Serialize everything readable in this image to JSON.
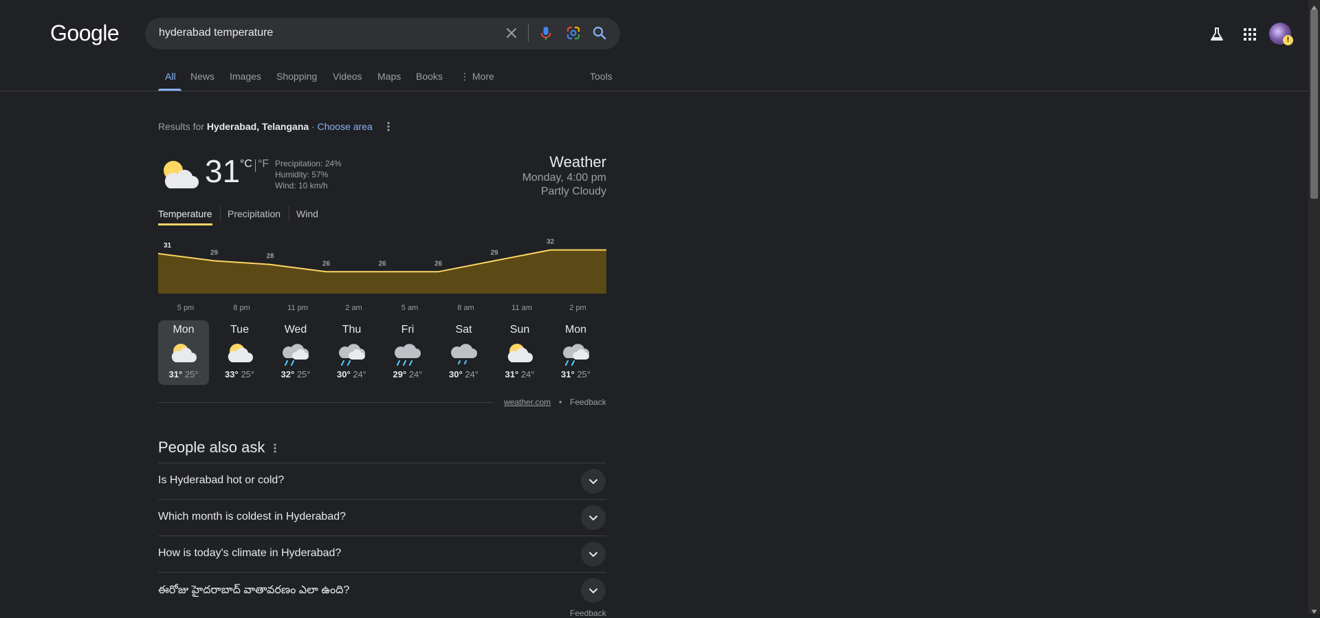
{
  "header": {
    "logo": "Google",
    "query": "hyderabad temperature",
    "icons": {
      "clear": "close-icon",
      "mic": "microphone-icon",
      "lens": "lens-icon",
      "search": "search-icon",
      "labs": "labs-flask-icon",
      "apps": "apps-grid-icon",
      "avatar": "account-avatar",
      "warning": "!"
    }
  },
  "tabs": {
    "all": "All",
    "news": "News",
    "images": "Images",
    "shopping": "Shopping",
    "videos": "Videos",
    "maps": "Maps",
    "books": "Books",
    "more": "More",
    "tools": "Tools"
  },
  "results_for": {
    "prefix": "Results for",
    "location": "Hyderabad, Telangana",
    "separator": "·",
    "choose_area": "Choose area"
  },
  "weather": {
    "temp": "31",
    "unit_c": "°C",
    "unit_f": "°F",
    "precipitation": "Precipitation: 24%",
    "humidity": "Humidity: 57%",
    "wind": "Wind: 10 km/h",
    "title": "Weather",
    "datetime": "Monday, 4:00 pm",
    "condition": "Partly Cloudy",
    "tabs": {
      "temperature": "Temperature",
      "precipitation": "Precipitation",
      "wind": "Wind"
    },
    "days": [
      {
        "name": "Mon",
        "high": "31°",
        "low": "25°",
        "icon": "partly-cloudy-icon"
      },
      {
        "name": "Tue",
        "high": "33°",
        "low": "25°",
        "icon": "partly-cloudy-icon"
      },
      {
        "name": "Wed",
        "high": "32°",
        "low": "25°",
        "icon": "scattered-showers-icon"
      },
      {
        "name": "Thu",
        "high": "30°",
        "low": "24°",
        "icon": "scattered-showers-icon"
      },
      {
        "name": "Fri",
        "high": "29°",
        "low": "24°",
        "icon": "rain-icon"
      },
      {
        "name": "Sat",
        "high": "30°",
        "low": "24°",
        "icon": "light-rain-icon"
      },
      {
        "name": "Sun",
        "high": "31°",
        "low": "24°",
        "icon": "partly-cloudy-icon"
      },
      {
        "name": "Mon",
        "high": "31°",
        "low": "25°",
        "icon": "scattered-showers-icon"
      }
    ],
    "source": "weather.com",
    "dot": "•",
    "feedback": "Feedback",
    "colors": {
      "line": "#fdd663",
      "fill": "#5c4a16"
    }
  },
  "chart_data": {
    "type": "area",
    "title": "",
    "xlabel": "",
    "ylabel": "",
    "x": [
      "5 pm",
      "8 pm",
      "11 pm",
      "2 am",
      "5 am",
      "8 am",
      "11 am",
      "2 pm"
    ],
    "series": [
      {
        "values": [
          31,
          29,
          28,
          26,
          26,
          26,
          29,
          32
        ]
      }
    ],
    "labels": [
      "31",
      "29",
      "28",
      "26",
      "26",
      "26",
      "29",
      "32"
    ],
    "ylim": [
      20,
      34
    ],
    "grid": false
  },
  "paa": {
    "title": "People also ask",
    "questions": [
      "Is Hyderabad hot or cold?",
      "Which month is coldest in Hyderabad?",
      "How is today's climate in Hyderabad?",
      "ఈరోజు హైదరాబాద్ వాతావరణం ఎలా ఉంది?"
    ],
    "feedback": "Feedback"
  }
}
